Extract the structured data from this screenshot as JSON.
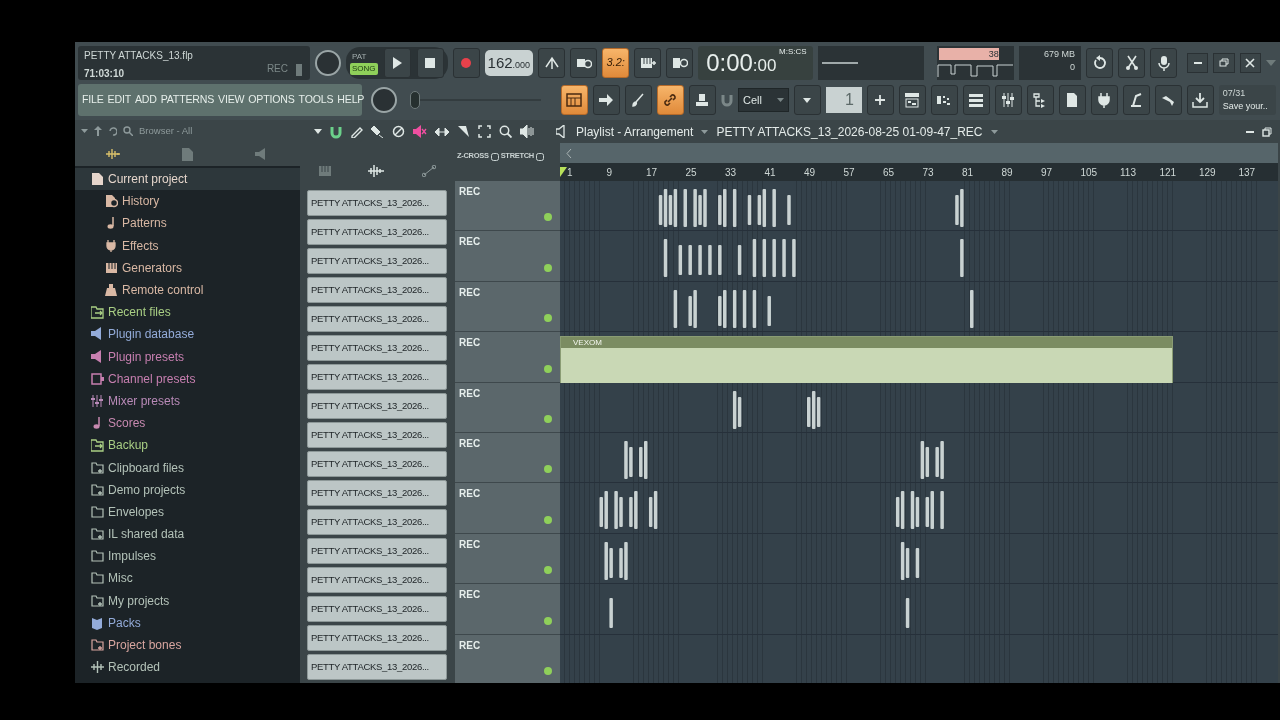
{
  "project": {
    "filename": "PETTY ATTACKS_13.flp",
    "time": "71:03:10",
    "rec": "REC"
  },
  "transport": {
    "modes": [
      {
        "label": "PAT",
        "selected": false
      },
      {
        "label": "SONG",
        "selected": true
      }
    ],
    "tempo": "162",
    "tempo_fraction": ".000",
    "snap": "3.2:",
    "snap_on": true
  },
  "time_display": {
    "time": "0:00",
    "centiseconds": ":00",
    "format": "M:S:CS"
  },
  "monitor": {
    "cpu": "38",
    "memory": "679 MB",
    "polyphony": "0"
  },
  "menu": [
    "FILE",
    "EDIT",
    "ADD",
    "PATTERNS",
    "VIEW",
    "OPTIONS",
    "TOOLS",
    "HELP"
  ],
  "tools": [
    {
      "on": true
    },
    {
      "on": false
    },
    {
      "on": false
    },
    {
      "on": true
    },
    {
      "on": false
    }
  ],
  "snap_select": {
    "value": "Cell"
  },
  "pattern_selector": {
    "value": "1"
  },
  "master_pitch": {
    "level": 0
  },
  "hint": {
    "counter": "07/31",
    "text": "Save your.."
  },
  "browser": {
    "title": "Browser - All",
    "items": [
      {
        "label": "Current project",
        "kind": "project",
        "color": "#e6d6cc",
        "expanded": true,
        "children": [
          {
            "label": "History",
            "kind": "history",
            "color": "#d9b8a4"
          },
          {
            "label": "Patterns",
            "kind": "note",
            "color": "#d9b8a4"
          },
          {
            "label": "Effects",
            "kind": "plug",
            "color": "#d9b8a4"
          },
          {
            "label": "Generators",
            "kind": "piano",
            "color": "#d9b8a4"
          },
          {
            "label": "Remote control",
            "kind": "remote",
            "color": "#d9b8a4"
          }
        ]
      },
      {
        "label": "Recent files",
        "kind": "folder-refresh",
        "color": "#a9cf84"
      },
      {
        "label": "Plugin database",
        "kind": "speaker",
        "color": "#93abd9"
      },
      {
        "label": "Plugin presets",
        "kind": "speaker",
        "color": "#c77fb0"
      },
      {
        "label": "Channel presets",
        "kind": "box",
        "color": "#c77fb0"
      },
      {
        "label": "Mixer presets",
        "kind": "sliders",
        "color": "#b98ab8"
      },
      {
        "label": "Scores",
        "kind": "note",
        "color": "#c789b0"
      },
      {
        "label": "Backup",
        "kind": "folder-refresh",
        "color": "#a9cf84"
      },
      {
        "label": "Clipboard files",
        "kind": "folder-plus",
        "color": "#b3c2b8"
      },
      {
        "label": "Demo projects",
        "kind": "folder-plus",
        "color": "#b3c2b8"
      },
      {
        "label": "Envelopes",
        "kind": "folder",
        "color": "#b3c2b8"
      },
      {
        "label": "IL shared data",
        "kind": "folder-plus",
        "color": "#b3c2b8"
      },
      {
        "label": "Impulses",
        "kind": "folder",
        "color": "#b3c2b8"
      },
      {
        "label": "Misc",
        "kind": "folder",
        "color": "#b3c2b8"
      },
      {
        "label": "My projects",
        "kind": "folder-plus",
        "color": "#b3c2b8"
      },
      {
        "label": "Packs",
        "kind": "packs",
        "color": "#93abd9"
      },
      {
        "label": "Project bones",
        "kind": "folder-plus",
        "color": "#d9a6a0"
      },
      {
        "label": "Recorded",
        "kind": "wave",
        "color": "#b3c2b8"
      }
    ]
  },
  "patterns": [
    "PETTY ATTACKS_13_2026...",
    "PETTY ATTACKS_13_2026...",
    "PETTY ATTACKS_13_2026...",
    "PETTY ATTACKS_13_2026...",
    "PETTY ATTACKS_13_2026...",
    "PETTY ATTACKS_13_2026...",
    "PETTY ATTACKS_13_2026...",
    "PETTY ATTACKS_13_2026...",
    "PETTY ATTACKS_13_2026...",
    "PETTY ATTACKS_13_2026...",
    "PETTY ATTACKS_13_2026...",
    "PETTY ATTACKS_13_2026...",
    "PETTY ATTACKS_13_2026...",
    "PETTY ATTACKS_13_2026...",
    "PETTY ATTACKS_13_2026...",
    "PETTY ATTACKS_13_2026...",
    "PETTY ATTACKS_13_2026..."
  ],
  "playlist": {
    "title": "Playlist - Arrangement",
    "arrangement": "PETTY ATTACKS_13_2026-08-25 01-09-47_REC",
    "zcross": "Z-CROSS",
    "stretch": "STRETCH",
    "ruler": [
      "1",
      "9",
      "17",
      "25",
      "33",
      "41",
      "49",
      "57",
      "65",
      "73",
      "81",
      "89",
      "97",
      "105",
      "113",
      "121",
      "129",
      "137"
    ],
    "tracks": [
      {
        "label": "REC",
        "enabled": true
      },
      {
        "label": "REC",
        "enabled": true
      },
      {
        "label": "REC",
        "enabled": true
      },
      {
        "label": "REC",
        "enabled": true,
        "clip": "VEXOM"
      },
      {
        "label": "REC",
        "enabled": true
      },
      {
        "label": "REC",
        "enabled": true
      },
      {
        "label": "REC",
        "enabled": true
      },
      {
        "label": "REC",
        "enabled": true
      },
      {
        "label": "REC",
        "enabled": true
      },
      {
        "label": "REC",
        "enabled": true
      }
    ]
  }
}
